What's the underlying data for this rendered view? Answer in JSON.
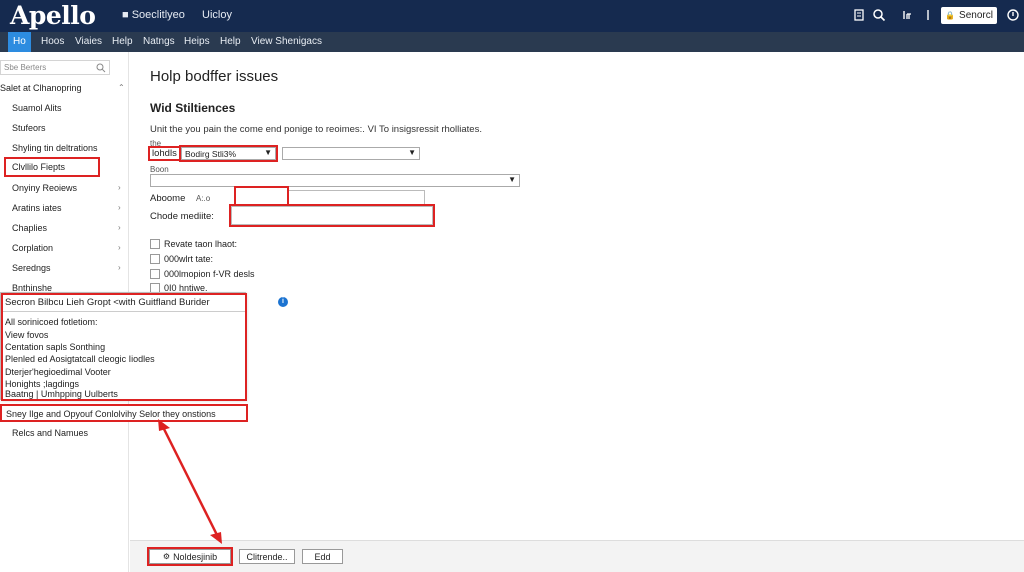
{
  "app": {
    "logo": "Apello"
  },
  "header": {
    "links": [
      "Soeclitlyeo",
      "Uicloy"
    ],
    "action_button": "Senorcl",
    "icons": [
      "document-icon",
      "search-icon",
      "notification-icon",
      "lock-icon",
      "power-icon"
    ]
  },
  "nav": {
    "items": [
      "Ho",
      "Hoos",
      "Viaies",
      "Help",
      "Natngs",
      "Heips",
      "Help",
      "View Shenigacs"
    ],
    "active_index": 0
  },
  "sidebar": {
    "search_placeholder": "Sbe Berters",
    "header": "Salet at Clhanopring",
    "items": [
      "Suamol Alits",
      "Stufeors",
      "Shyling tin deltrations",
      "Clvllilo Fiepts",
      "Onyiny Reoiews",
      "Aratins iates",
      "Chaplies",
      "Corplation",
      "Seredngs",
      "Bnthinshe",
      "Relcs and Namues"
    ],
    "highlighted_index": 3
  },
  "main": {
    "title": "Holp bodffer issues",
    "section_title": "Wid Stiltiences",
    "description": "Unit the you pain the come end ponige to reoimes:. VI To insigsressit rholliates.",
    "field1_label": "the",
    "field1_prefix": "lohdls",
    "field1_value": "Bodirg Stli3%",
    "field2_label": "Boon",
    "aboome_label": "Aboome",
    "aboome_value": "A:.o",
    "chode_label": "Chode mediite:",
    "checkboxes": [
      "Revate taon lhaot:",
      "000wlrt tate:",
      "000lmopion f-VR desls",
      "0I0 hntiwe."
    ]
  },
  "popup": {
    "title": "Secron Bilbcu Lieh Gropt <with Guitfland Burider",
    "items": [
      "All sorinicoed fotletiom:",
      "View fovos",
      "Centation sapls Sonthing",
      "Plenled ed Aosigtatcall cleogic Iiodles",
      "Dterjer'hegioedimal Vooter",
      "Honights ;lagdings",
      "Baatng | Umhpping Uulberts"
    ],
    "footer": "Sney Ilge and Opyouf Conlolvihy Selor they onstions"
  },
  "bottom": {
    "primary_button": "Noldesjinib",
    "secondary_button": "Clitrende..",
    "tertiary_button": "Edd"
  },
  "colors": {
    "header_bg": "#152a4f",
    "nav_bg": "#2a3a50",
    "nav_active": "#2d8ce0",
    "annotation": "#d22222"
  }
}
